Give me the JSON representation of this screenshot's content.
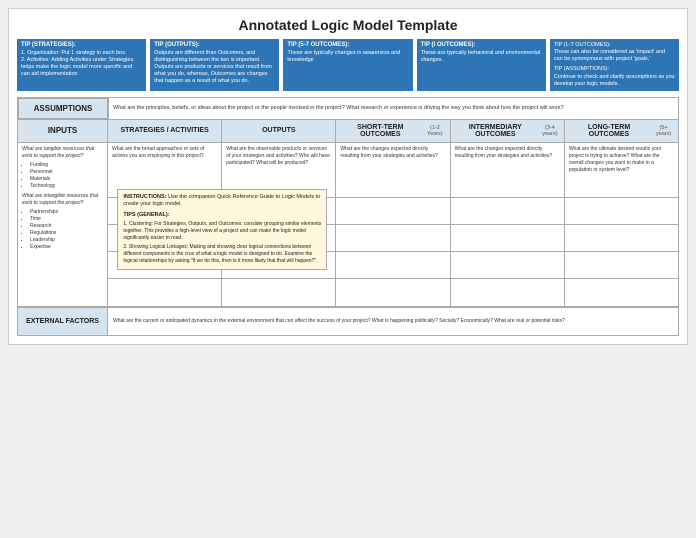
{
  "title": "Annotated Logic Model Template",
  "tips": [
    {
      "id": "tip-strategies",
      "title": "TIP (STRATEGIES):",
      "lines": [
        "1. Organization: Put 1 strategy in each box.",
        "2. Activities: Adding Activities under Strategies helps make the logic model more specific and can aid implementation"
      ]
    },
    {
      "id": "tip-outputs",
      "title": "TIP (OUTPUTS):",
      "lines": [
        "Outputs are different than Outcomes, and distinguishing between the two is important. Outputs are products or services that result from what you do, whereas, Outcomes are changes that happen as a result of what you do."
      ]
    },
    {
      "id": "tip-outcomes-57",
      "title": "TIP (5-7 OUTCOMES):",
      "lines": [
        "These are typically changes in awareness and knowledge"
      ]
    },
    {
      "id": "tip-outcomes-i",
      "title": "TIP (I OUTCOMES):",
      "lines": [
        "These are typically behavioral and environmental changes."
      ]
    },
    {
      "id": "tip-outcomes-lt",
      "title": "TIP (L-T OUTCOMES):",
      "lines": [
        "These can also be considered as 'impact' and can be synonymous with project 'goals.'"
      ],
      "extra_title": "TIP (ASSUMPTIONS):",
      "extra_lines": [
        "Continue to check and clarify assumptions as you develop your logic models."
      ]
    }
  ],
  "assumptions": {
    "label": "ASSUMPTIONS",
    "text": "What are the principles, beliefs, or ideas about the project or the people involved in the project? What research or experience is driving the way you think about how the project will work?"
  },
  "columns": {
    "inputs": "INPUTS",
    "strategies": "STRATEGIES / ACTIVITIES",
    "outputs": "OUTPUTS",
    "short_term": {
      "label": "SHORT-TERM OUTCOMES",
      "sub": "(1-2 Years)"
    },
    "intermediary": {
      "label": "INTERMEDIARY OUTCOMES",
      "sub": "(3-4 years)"
    },
    "long_term": {
      "label": "LONG-TERM OUTCOMES",
      "sub": "(5+ years)"
    }
  },
  "inputs_tangible": {
    "label": "What are tangible resources that exist to support the project?",
    "items": [
      "Funding",
      "Personnel",
      "Materials",
      "Technology"
    ]
  },
  "inputs_intangible": {
    "label": "What are intangible resources that exist to support the project?",
    "items": [
      "Partnerships",
      "Time",
      "Research",
      "Regulations",
      "Leadership",
      "Expertise"
    ]
  },
  "strategies_desc": "What are the broad approaches or sets of actions you are employing in this project?",
  "outputs_desc": "What are the observable products or services of your strategies and activities? Who will have participated? What will be produced?",
  "short_term_desc": "What are the changes expected directly resulting from your strategies and activities?",
  "intermediary_desc": "What are the changes expected directly resulting from your strategies and activities?",
  "long_term_desc": "What are the ultimate desired results your project is trying to achieve? What are the overall changes you want to make in a population or system level?",
  "instructions": {
    "title": "INSTRUCTIONS:",
    "text": "Use the companion Quick Reference Guide to Logic Models to create your logic model.",
    "tips_title": "TIPS (GENERAL):",
    "tips_items": [
      "1. Clustering: For Strategies, Outputs, and Outcomes: consider grouping similar elements together. This provides a high-level view of a project and can make the logic model significantly easier to read.",
      "2. Showing Logical Linkages: Making and showing clear logical connections between different components is the crux of what a logic model is designed to do. Examine the logical relationships by asking \"if we do this, then is it more likely that that will happen?\"."
    ]
  },
  "external_factors": {
    "label": "EXTERNAL FACTORS",
    "text": "What are the current or anticipated dynamics in the external environment that can affect the success of your project? What is happening politically? Socially? Economically? What are real or potential risks?"
  }
}
